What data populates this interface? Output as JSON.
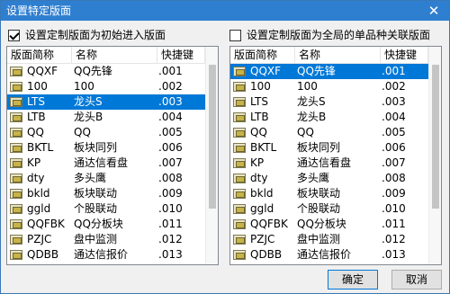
{
  "window": {
    "title": "设置特定版面",
    "close_glyph": "✕"
  },
  "left_panel": {
    "checkbox_checked": true,
    "checkbox_label": "设置定制版面为初始进入版面",
    "columns": [
      "版面简称",
      "名称",
      "快捷键"
    ],
    "selected_index": 2,
    "rows": [
      {
        "abbr": "QQXF",
        "name": "QQ先锋",
        "key": ".001"
      },
      {
        "abbr": "100",
        "name": "100",
        "key": ".002"
      },
      {
        "abbr": "LTS",
        "name": "龙头S",
        "key": ".003"
      },
      {
        "abbr": "LTB",
        "name": "龙头B",
        "key": ".004"
      },
      {
        "abbr": "QQ",
        "name": "QQ",
        "key": ".005"
      },
      {
        "abbr": "BKTL",
        "name": "板块同列",
        "key": ".006"
      },
      {
        "abbr": "KP",
        "name": "通达信看盘",
        "key": ".007"
      },
      {
        "abbr": "dty",
        "name": "多头鹰",
        "key": ".008"
      },
      {
        "abbr": "bkld",
        "name": "板块联动",
        "key": ".009"
      },
      {
        "abbr": "ggld",
        "name": "个股联动",
        "key": ".010"
      },
      {
        "abbr": "QQFBK",
        "name": "QQ分板块",
        "key": ".011"
      },
      {
        "abbr": "PZJC",
        "name": "盘中监测",
        "key": ".012"
      },
      {
        "abbr": "QDBB",
        "name": "通达信报价",
        "key": ".013"
      }
    ]
  },
  "right_panel": {
    "checkbox_checked": false,
    "checkbox_label": "设置定制版面为全局的单品种关联版面",
    "columns": [
      "版面简称",
      "名称",
      "快捷键"
    ],
    "selected_index": 0,
    "rows": [
      {
        "abbr": "QQXF",
        "name": "QQ先锋",
        "key": ".001"
      },
      {
        "abbr": "100",
        "name": "100",
        "key": ".002"
      },
      {
        "abbr": "LTS",
        "name": "龙头S",
        "key": ".003"
      },
      {
        "abbr": "LTB",
        "name": "龙头B",
        "key": ".004"
      },
      {
        "abbr": "QQ",
        "name": "QQ",
        "key": ".005"
      },
      {
        "abbr": "BKTL",
        "name": "板块同列",
        "key": ".006"
      },
      {
        "abbr": "KP",
        "name": "通达信看盘",
        "key": ".007"
      },
      {
        "abbr": "dty",
        "name": "多头鹰",
        "key": ".008"
      },
      {
        "abbr": "bkld",
        "name": "板块联动",
        "key": ".009"
      },
      {
        "abbr": "ggld",
        "name": "个股联动",
        "key": ".010"
      },
      {
        "abbr": "QQFBK",
        "name": "QQ分板块",
        "key": ".011"
      },
      {
        "abbr": "PZJC",
        "name": "盘中监测",
        "key": ".012"
      },
      {
        "abbr": "QDBB",
        "name": "通达信报价",
        "key": ".013"
      }
    ]
  },
  "buttons": {
    "ok": "确定",
    "cancel": "取消"
  },
  "colors": {
    "titlebar": "#2f7fd0",
    "selection": "#0078d7"
  }
}
